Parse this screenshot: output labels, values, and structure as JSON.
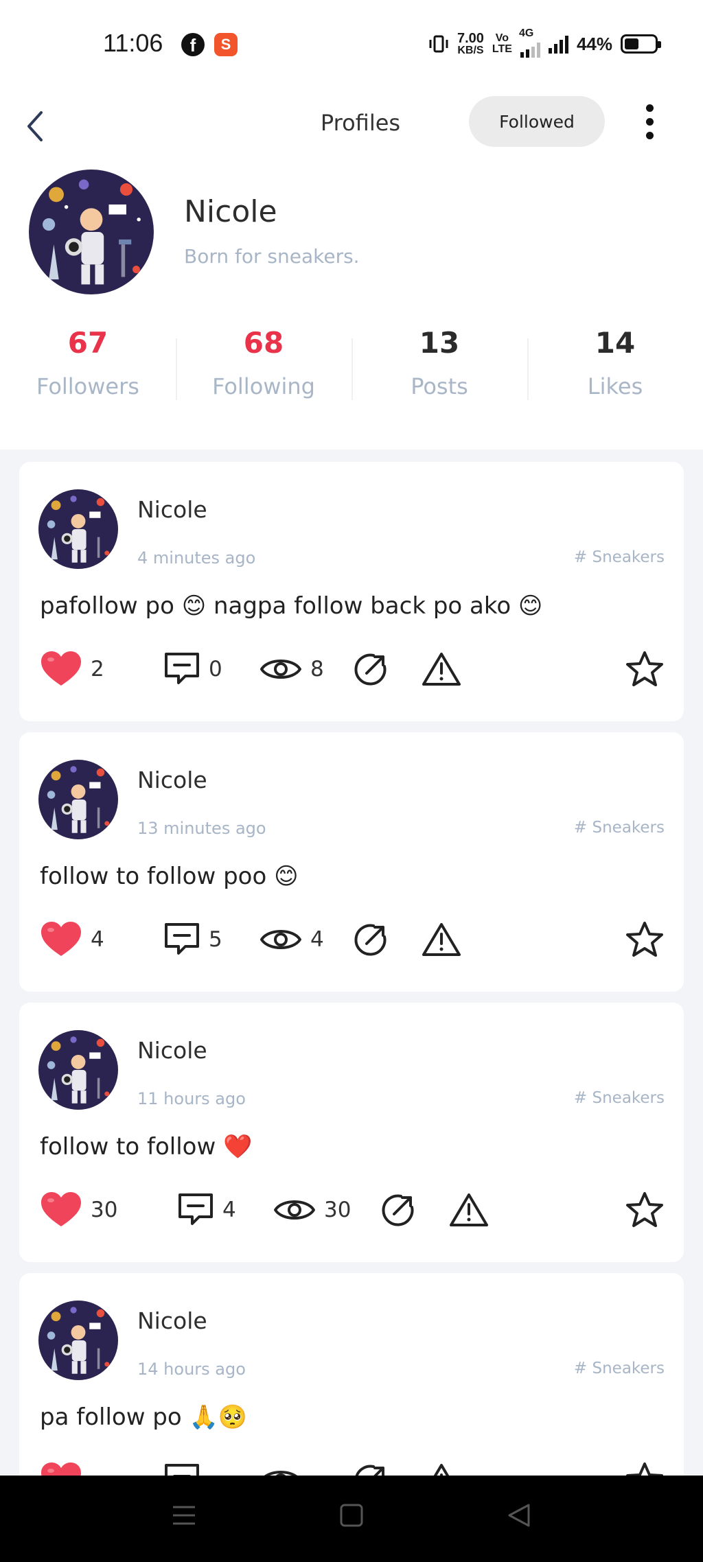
{
  "status_bar": {
    "time": "11:06",
    "net_speed_value": "7.00",
    "net_speed_unit": "KB/S",
    "volte_top": "Vo",
    "volte_bottom": "LTE",
    "network": "4G",
    "battery": "44%",
    "apps": [
      "facebook-icon",
      "shopee-icon"
    ]
  },
  "header": {
    "title": "Profiles",
    "followed_label": "Followed"
  },
  "profile": {
    "name": "Nicole",
    "bio": "Born for sneakers.",
    "stats": [
      {
        "value": "67",
        "label": "Followers",
        "color": "#e8334a"
      },
      {
        "value": "68",
        "label": "Following",
        "color": "#e8334a"
      },
      {
        "value": "13",
        "label": "Posts",
        "color": "#2b2b2b"
      },
      {
        "value": "14",
        "label": "Likes",
        "color": "#2b2b2b"
      }
    ]
  },
  "posts": [
    {
      "author": "Nicole",
      "time": "4 minutes ago",
      "tag": "# Sneakers",
      "text": "pafollow po 😊 nagpa follow back po ako 😊",
      "likes": "2",
      "comments": "0",
      "views": "8"
    },
    {
      "author": "Nicole",
      "time": "13 minutes ago",
      "tag": "# Sneakers",
      "text": "follow to follow poo 😊",
      "likes": "4",
      "comments": "5",
      "views": "4"
    },
    {
      "author": "Nicole",
      "time": "11 hours ago",
      "tag": "# Sneakers",
      "text": "follow to follow ❤️",
      "likes": "30",
      "comments": "4",
      "views": "30"
    },
    {
      "author": "Nicole",
      "time": "14 hours ago",
      "tag": "# Sneakers",
      "text": "pa follow po 🙏🥺",
      "likes": "",
      "comments": "",
      "views": ""
    }
  ],
  "colors": {
    "accent_red": "#e8334a",
    "muted_text": "#a7b5c6",
    "heart": "#f0445a"
  }
}
